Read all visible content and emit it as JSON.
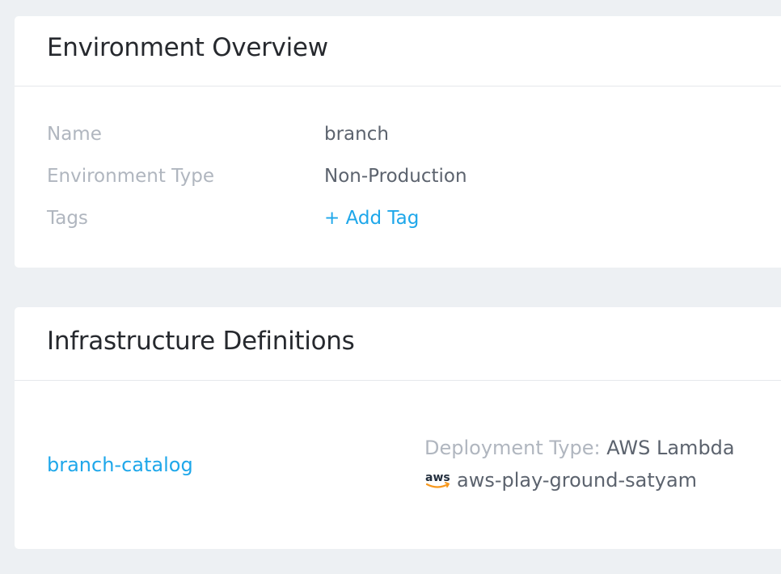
{
  "overview": {
    "title": "Environment Overview",
    "rows": [
      {
        "label": "Name",
        "value": "branch"
      },
      {
        "label": "Environment Type",
        "value": "Non-Production"
      },
      {
        "label": "Tags",
        "value": "+ Add Tag"
      }
    ]
  },
  "infrastructure": {
    "title": "Infrastructure Definitions",
    "items": [
      {
        "name": "branch-catalog",
        "deployment_type_label": "Deployment Type:",
        "deployment_type_value": "AWS Lambda",
        "cloud_provider_icon": "aws-icon",
        "account": "aws-play-ground-satyam"
      }
    ]
  },
  "colors": {
    "background": "#edf0f3",
    "card": "#ffffff",
    "link": "#1ea7ea",
    "label": "#b0b6bf",
    "value": "#5c636e",
    "title": "#26292e",
    "aws_orange": "#f7981d",
    "aws_text": "#232f3e"
  }
}
